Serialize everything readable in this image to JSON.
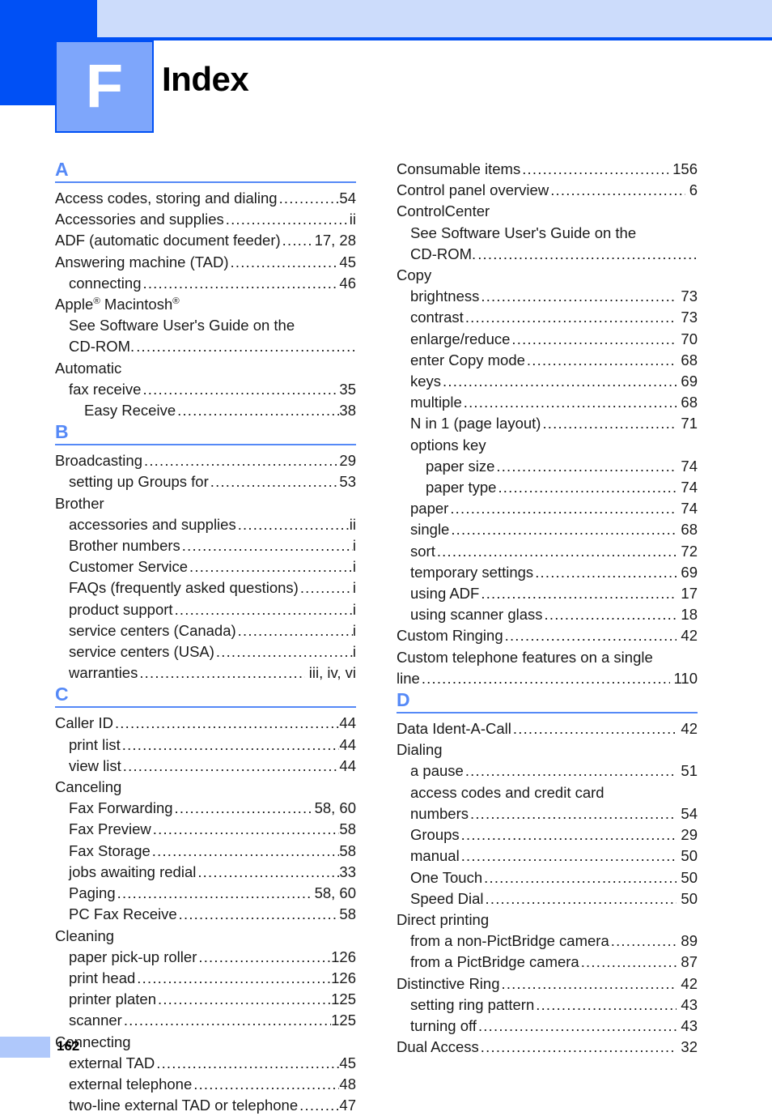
{
  "header": {
    "chapter_letter": "F",
    "title": "Index",
    "accent_color": "#0050F5",
    "band_color": "#CCDCFB",
    "badge_color": "#7EA6FB"
  },
  "footer": {
    "page_number": "162"
  },
  "leader_dots": "................................................................................................................",
  "columns": [
    {
      "id": "left",
      "sections": [
        {
          "letter": "A",
          "entries": [
            {
              "label": "Access codes, storing and dialing",
              "pages": "54",
              "level": 1,
              "leader": true
            },
            {
              "label": "Accessories and supplies ",
              "pages": "ii",
              "level": 1,
              "leader": true
            },
            {
              "label": "ADF (automatic document feeder) ",
              "pages": "17, 28",
              "level": 1,
              "leader": true,
              "gap": true
            },
            {
              "label": "Answering machine (TAD) ",
              "pages": "45",
              "level": 1,
              "leader": true
            },
            {
              "label": "connecting ",
              "pages": "46",
              "level": 2,
              "leader": true
            },
            {
              "label": "Apple® Macintosh®",
              "pages": "",
              "level": 1,
              "leader": false,
              "html": true
            },
            {
              "label": "See Software User's Guide on the",
              "pages": "",
              "level": 2,
              "leader": false
            },
            {
              "label": "CD-ROM. ",
              "pages": "",
              "level": 2,
              "leader": true
            },
            {
              "label": "Automatic",
              "pages": "",
              "level": 1,
              "leader": false
            },
            {
              "label": "fax receive ",
              "pages": "35",
              "level": 2,
              "leader": true
            },
            {
              "label": "Easy Receive ",
              "pages": "38",
              "level": 3,
              "leader": true
            }
          ]
        },
        {
          "letter": "B",
          "entries": [
            {
              "label": "Broadcasting ",
              "pages": "29",
              "level": 1,
              "leader": true
            },
            {
              "label": "setting up Groups for ",
              "pages": "53",
              "level": 2,
              "leader": true
            },
            {
              "label": "Brother",
              "pages": "",
              "level": 1,
              "leader": false
            },
            {
              "label": "accessories and supplies ",
              "pages": "ii",
              "level": 2,
              "leader": true
            },
            {
              "label": "Brother numbers ",
              "pages": "i",
              "level": 2,
              "leader": true
            },
            {
              "label": "Customer Service ",
              "pages": "i",
              "level": 2,
              "leader": true
            },
            {
              "label": "FAQs (frequently asked questions) ",
              "pages": "i",
              "level": 2,
              "leader": true
            },
            {
              "label": "product support ",
              "pages": "i",
              "level": 2,
              "leader": true
            },
            {
              "label": "service centers (Canada) ",
              "pages": "i",
              "level": 2,
              "leader": true
            },
            {
              "label": "service centers (USA) ",
              "pages": "i",
              "level": 2,
              "leader": true
            },
            {
              "label": "warranties ",
              "pages": "iii, iv, vi",
              "level": 2,
              "leader": true,
              "gap": true
            }
          ]
        },
        {
          "letter": "C",
          "entries": [
            {
              "label": "Caller ID ",
              "pages": "44",
              "level": 1,
              "leader": true
            },
            {
              "label": "print list ",
              "pages": "44",
              "level": 2,
              "leader": true
            },
            {
              "label": "view list ",
              "pages": "44",
              "level": 2,
              "leader": true
            },
            {
              "label": "Canceling",
              "pages": "",
              "level": 1,
              "leader": false
            },
            {
              "label": "Fax Forwarding ",
              "pages": "58, 60",
              "level": 2,
              "leader": true,
              "gap": true
            },
            {
              "label": "Fax Preview ",
              "pages": "58",
              "level": 2,
              "leader": true
            },
            {
              "label": "Fax Storage ",
              "pages": "58",
              "level": 2,
              "leader": true
            },
            {
              "label": "jobs awaiting redial ",
              "pages": "33",
              "level": 2,
              "leader": true
            },
            {
              "label": "Paging ",
              "pages": "58, 60",
              "level": 2,
              "leader": true,
              "gap": true
            },
            {
              "label": "PC Fax Receive ",
              "pages": "58",
              "level": 2,
              "leader": true
            },
            {
              "label": "Cleaning",
              "pages": "",
              "level": 1,
              "leader": false
            },
            {
              "label": "paper pick-up roller ",
              "pages": "126",
              "level": 2,
              "leader": true
            },
            {
              "label": "print head ",
              "pages": "126",
              "level": 2,
              "leader": true
            },
            {
              "label": "printer platen ",
              "pages": "125",
              "level": 2,
              "leader": true
            },
            {
              "label": "scanner ",
              "pages": "125",
              "level": 2,
              "leader": true
            },
            {
              "label": "Connecting",
              "pages": "",
              "level": 1,
              "leader": false
            },
            {
              "label": "external TAD ",
              "pages": "45",
              "level": 2,
              "leader": true
            },
            {
              "label": "external telephone ",
              "pages": "48",
              "level": 2,
              "leader": true
            },
            {
              "label": "two-line external TAD or telephone ",
              "pages": "47",
              "level": 2,
              "leader": true
            }
          ]
        }
      ]
    },
    {
      "id": "right",
      "sections": [
        {
          "letter": "",
          "entries": [
            {
              "label": "Consumable items ",
              "pages": "156",
              "level": 1,
              "leader": true,
              "gap": true
            },
            {
              "label": "Control panel overview ",
              "pages": "6",
              "level": 1,
              "leader": true,
              "gap": true
            },
            {
              "label": "ControlCenter",
              "pages": "",
              "level": 1,
              "leader": false
            },
            {
              "label": "See Software User's Guide on the",
              "pages": "",
              "level": 2,
              "leader": false
            },
            {
              "label": "CD-ROM. ",
              "pages": "",
              "level": 2,
              "leader": true
            },
            {
              "label": "Copy",
              "pages": "",
              "level": 1,
              "leader": false
            },
            {
              "label": "brightness ",
              "pages": "73",
              "level": 2,
              "leader": true,
              "gap": true
            },
            {
              "label": "contrast ",
              "pages": "73",
              "level": 2,
              "leader": true,
              "gap": true
            },
            {
              "label": "enlarge/reduce ",
              "pages": "70",
              "level": 2,
              "leader": true,
              "gap": true
            },
            {
              "label": "enter Copy mode ",
              "pages": "68",
              "level": 2,
              "leader": true,
              "gap": true
            },
            {
              "label": "keys ",
              "pages": "69",
              "level": 2,
              "leader": true,
              "gap": true
            },
            {
              "label": "multiple ",
              "pages": "68",
              "level": 2,
              "leader": true,
              "gap": true
            },
            {
              "label": "N in 1 (page layout) ",
              "pages": "71",
              "level": 2,
              "leader": true,
              "gap": true
            },
            {
              "label": "options key",
              "pages": "",
              "level": 2,
              "leader": false
            },
            {
              "label": "paper size ",
              "pages": "74",
              "level": 3,
              "leader": true,
              "gap": true
            },
            {
              "label": "paper type ",
              "pages": "74",
              "level": 3,
              "leader": true,
              "gap": true
            },
            {
              "label": "paper ",
              "pages": "74",
              "level": 2,
              "leader": true,
              "gap": true
            },
            {
              "label": "single ",
              "pages": "68",
              "level": 2,
              "leader": true,
              "gap": true
            },
            {
              "label": "sort ",
              "pages": "72",
              "level": 2,
              "leader": true,
              "gap": true
            },
            {
              "label": "temporary settings ",
              "pages": "69",
              "level": 2,
              "leader": true,
              "gap": true
            },
            {
              "label": "using ADF ",
              "pages": "17",
              "level": 2,
              "leader": true,
              "gap": true
            },
            {
              "label": "using scanner glass ",
              "pages": "18",
              "level": 2,
              "leader": true,
              "gap": true
            },
            {
              "label": "Custom Ringing ",
              "pages": "42",
              "level": 1,
              "leader": true,
              "gap": true
            },
            {
              "label": "Custom telephone features on a single",
              "pages": "",
              "level": 1,
              "leader": false
            },
            {
              "label": "line ",
              "pages": "110",
              "level": 1,
              "leader": true,
              "gap": true
            }
          ]
        },
        {
          "letter": "D",
          "entries": [
            {
              "label": "Data Ident-A-Call ",
              "pages": "42",
              "level": 1,
              "leader": true,
              "gap": true
            },
            {
              "label": "Dialing",
              "pages": "",
              "level": 1,
              "leader": false
            },
            {
              "label": "a pause ",
              "pages": "51",
              "level": 2,
              "leader": true,
              "gap": true
            },
            {
              "label": "access codes and credit card",
              "pages": "",
              "level": 2,
              "leader": false
            },
            {
              "label": "numbers ",
              "pages": "54",
              "level": 2,
              "leader": true,
              "gap": true
            },
            {
              "label": "Groups ",
              "pages": "29",
              "level": 2,
              "leader": true,
              "gap": true
            },
            {
              "label": "manual ",
              "pages": "50",
              "level": 2,
              "leader": true,
              "gap": true
            },
            {
              "label": "One Touch ",
              "pages": "50",
              "level": 2,
              "leader": true,
              "gap": true
            },
            {
              "label": "Speed Dial ",
              "pages": "50",
              "level": 2,
              "leader": true,
              "gap": true
            },
            {
              "label": "Direct printing",
              "pages": "",
              "level": 1,
              "leader": false
            },
            {
              "label": "from a non-PictBridge camera ",
              "pages": "89",
              "level": 2,
              "leader": true,
              "gap": true
            },
            {
              "label": "from a PictBridge camera ",
              "pages": "87",
              "level": 2,
              "leader": true,
              "gap": true
            },
            {
              "label": "Distinctive Ring ",
              "pages": "42",
              "level": 1,
              "leader": true,
              "gap": true
            },
            {
              "label": "setting ring pattern ",
              "pages": "43",
              "level": 2,
              "leader": true,
              "gap": true
            },
            {
              "label": "turning off ",
              "pages": "43",
              "level": 2,
              "leader": true,
              "gap": true
            },
            {
              "label": "Dual Access ",
              "pages": "32",
              "level": 1,
              "leader": true,
              "gap": true
            }
          ]
        }
      ]
    }
  ]
}
